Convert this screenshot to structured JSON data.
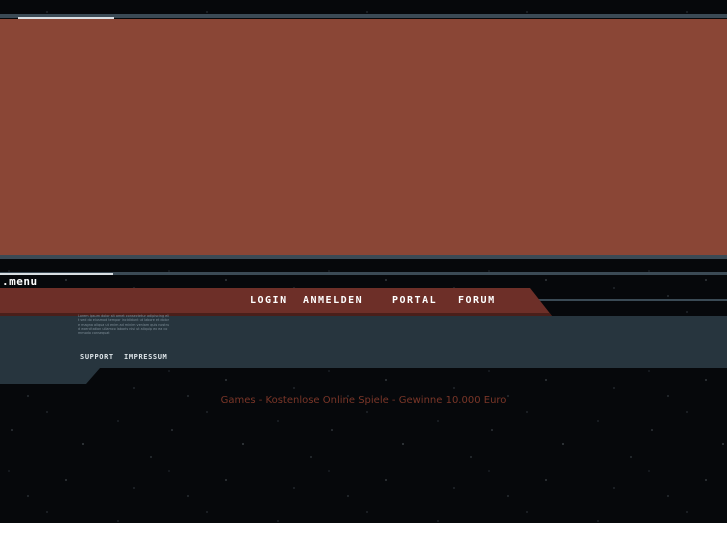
{
  "menu": {
    "label": ".menu"
  },
  "nav": {
    "login": "Login",
    "anmelden": "Anmelden",
    "portal": "Portal",
    "forum": "Forum"
  },
  "info": {
    "small_text": "Lorem ipsum dolor sit amet consectetur adipiscing elit sed do eiusmod tempor incididunt ut labore et dolore magna aliqua ut enim ad minim veniam quis nostrud exercitation ullamco laboris nisi ut aliquip ex ea commodo consequat"
  },
  "footer": {
    "support": "Support",
    "impressum": "Impressum"
  },
  "tagline": "Games - Kostenlose Online Spiele - Gewinne 10.000 Euro",
  "colors": {
    "main_panel": "#8a4636",
    "nav_bar": "#6d2f28",
    "content_panel": "#27353e",
    "tagline": "#7a3628"
  }
}
